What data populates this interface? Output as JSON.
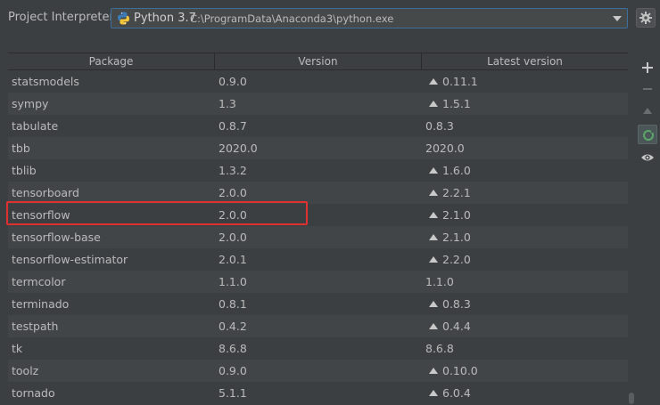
{
  "interpreter": {
    "label": "Project Interpreter:",
    "name": "Python 3.7",
    "path": "C:\\ProgramData\\Anaconda3\\python.exe"
  },
  "table": {
    "headers": [
      "Package",
      "Version",
      "Latest version"
    ],
    "rows": [
      {
        "package": "statsmodels",
        "version": "0.9.0",
        "latest": "0.11.1",
        "upgrade": true
      },
      {
        "package": "sympy",
        "version": "1.3",
        "latest": "1.5.1",
        "upgrade": true
      },
      {
        "package": "tabulate",
        "version": "0.8.7",
        "latest": "0.8.3",
        "upgrade": false
      },
      {
        "package": "tbb",
        "version": "2020.0",
        "latest": "2020.0",
        "upgrade": false
      },
      {
        "package": "tblib",
        "version": "1.3.2",
        "latest": "1.6.0",
        "upgrade": true
      },
      {
        "package": "tensorboard",
        "version": "2.0.0",
        "latest": "2.2.1",
        "upgrade": true
      },
      {
        "package": "tensorflow",
        "version": "2.0.0",
        "latest": "2.1.0",
        "upgrade": true
      },
      {
        "package": "tensorflow-base",
        "version": "2.0.0",
        "latest": "2.1.0",
        "upgrade": true
      },
      {
        "package": "tensorflow-estimator",
        "version": "2.0.1",
        "latest": "2.2.0",
        "upgrade": true
      },
      {
        "package": "termcolor",
        "version": "1.1.0",
        "latest": "1.1.0",
        "upgrade": false
      },
      {
        "package": "terminado",
        "version": "0.8.1",
        "latest": "0.8.3",
        "upgrade": true
      },
      {
        "package": "testpath",
        "version": "0.4.2",
        "latest": "0.4.4",
        "upgrade": true
      },
      {
        "package": "tk",
        "version": "8.6.8",
        "latest": "8.6.8",
        "upgrade": false
      },
      {
        "package": "toolz",
        "version": "0.9.0",
        "latest": "0.10.0",
        "upgrade": true
      },
      {
        "package": "tornado",
        "version": "5.1.1",
        "latest": "6.0.4",
        "upgrade": true
      }
    ]
  },
  "sidebar": {
    "buttons": [
      {
        "icon": "plus-icon",
        "enabled": true
      },
      {
        "icon": "minus-icon",
        "enabled": false
      },
      {
        "icon": "upgrade-icon",
        "enabled": false
      },
      {
        "icon": "refresh-icon",
        "enabled": true,
        "active": true
      },
      {
        "icon": "eye-icon",
        "enabled": true
      }
    ]
  },
  "colors": {
    "background": "#3c3f41",
    "highlight": "#e0302f",
    "accent_border": "#3d6e9c",
    "refresh_green": "#59a869"
  }
}
